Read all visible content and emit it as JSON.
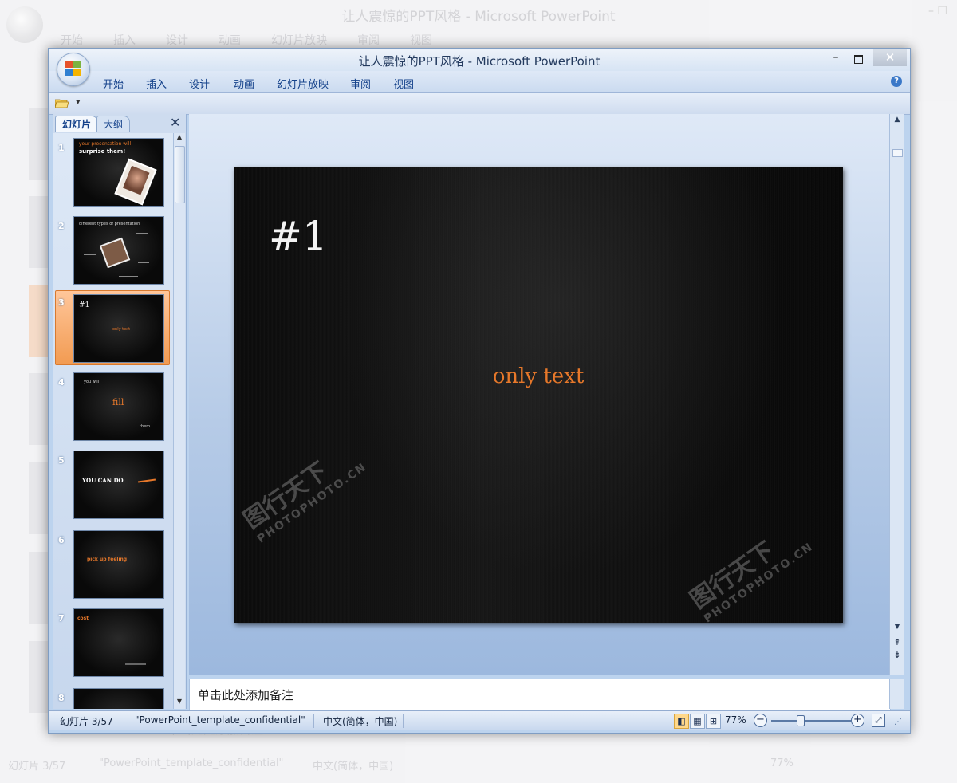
{
  "background_window": {
    "title": "让人震惊的PPT风格 - Microsoft PowerPoint",
    "tabs": [
      "开始",
      "插入",
      "设计",
      "动画",
      "幻灯片放映",
      "审阅",
      "视图"
    ],
    "notes_placeholder": "单击此处添加备注",
    "status_slide": "幻灯片 3/57",
    "status_theme": "\"PowerPoint_template_confidential\"",
    "status_language": "中文(简体，中国)",
    "status_zoom": "77%"
  },
  "window": {
    "title": "让人震惊的PPT风格 - Microsoft PowerPoint",
    "controls": {
      "minimize": "–",
      "close": "✕"
    }
  },
  "ribbon": {
    "tabs": [
      "开始",
      "插入",
      "设计",
      "动画",
      "幻灯片放映",
      "审阅",
      "视图"
    ],
    "help_icon": "?"
  },
  "quick_access": {
    "dropdown_label": "▾"
  },
  "slides_pane": {
    "tabs": [
      "幻灯片",
      "大纲"
    ],
    "active_tab": "幻灯片",
    "close_label": "✕",
    "selected_slide": 3,
    "thumbnails": [
      {
        "number": "1",
        "texts": [
          "your presentation will",
          "surprise them!"
        ]
      },
      {
        "number": "2",
        "texts": [
          "different types of presentation"
        ]
      },
      {
        "number": "3",
        "texts": [
          "#1",
          "only text"
        ]
      },
      {
        "number": "4",
        "texts": [
          "you will",
          "fill",
          "them"
        ]
      },
      {
        "number": "5",
        "texts": [
          "YOU CAN DO"
        ]
      },
      {
        "number": "6",
        "texts": [
          "pick up feeling"
        ]
      },
      {
        "number": "7",
        "texts": [
          "cost"
        ]
      },
      {
        "number": "8",
        "texts": []
      }
    ]
  },
  "slide": {
    "heading": "#1",
    "body": "only text",
    "heading_color": "#f3f3f3",
    "body_color": "#e7782a",
    "background": "dark brushed texture"
  },
  "notes": {
    "placeholder": "单击此处添加备注"
  },
  "status_bar": {
    "slide_indicator": "幻灯片 3/57",
    "theme_name": "\"PowerPoint_template_confidential\"",
    "language": "中文(简体，中国)",
    "zoom": "77%",
    "zoom_level": 0.77
  },
  "watermark": {
    "text": "图行天下",
    "subtext": "PHOTOPHOTO.CN"
  },
  "colors": {
    "accent_orange": "#e7782a",
    "ribbon_blue": "#15428b",
    "window_frame": "#bcd3ee"
  }
}
